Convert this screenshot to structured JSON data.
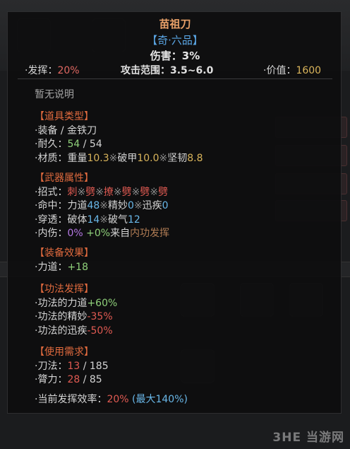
{
  "item": {
    "name": "苗祖刀",
    "grade": "【奇·六品】",
    "damage_label": "伤害：",
    "damage_value": "3%",
    "stats": {
      "attack_label": "·发挥：",
      "attack_value": "20%",
      "range_label": "攻击范围：",
      "range_value": "3.5~6.0",
      "price_label": "·价值：",
      "price_value": "1600"
    },
    "description": "暂无说明"
  },
  "sections": {
    "type": {
      "header": "【道具类型】",
      "equip": "·装备 / 金铁刀",
      "durability_label": "·耐久：",
      "durability_current": "54",
      "durability_sep": " / ",
      "durability_max": "54",
      "material_label": "·材质：",
      "material_weight_label": "重量",
      "material_weight": "10.3",
      "material_sep1": "※",
      "material_pierce_label": "破甲",
      "material_pierce": "10.0",
      "material_sep2": "※",
      "material_tough_label": "坚韧",
      "material_tough": "8.8"
    },
    "weapon": {
      "header": "【武器属性】",
      "moves_label": "·招式：",
      "moves": [
        "刺",
        "劈",
        "撩",
        "劈",
        "劈",
        "劈"
      ],
      "moves_sep": "※",
      "hit_label": "·命中：",
      "hit_a_label": "力道",
      "hit_a": "48",
      "hit_sep1": "※",
      "hit_b_label": "精妙",
      "hit_b": "0",
      "hit_sep2": "※",
      "hit_c_label": "迅疾",
      "hit_c": "0",
      "pen_label": "·穿透：",
      "pen_a_label": "破体",
      "pen_a": "14",
      "pen_sep": "※",
      "pen_b_label": "破气",
      "pen_b": "12",
      "inner_label": "·内伤：",
      "inner_a": "0%",
      "inner_b": "+0%",
      "inner_from": "来自",
      "inner_src": "内功发挥"
    },
    "effect": {
      "header": "【装备效果】",
      "strength_label": "·力道：",
      "strength_value": "+18"
    },
    "technique": {
      "header": "【功法发挥】",
      "l1_label": "·功法的力道",
      "l1_value": "+60%",
      "l2_label": "·功法的精妙",
      "l2_value": "-35%",
      "l3_label": "·功法的迅疾",
      "l3_value": "-50%"
    },
    "requirement": {
      "header": "【使用需求】",
      "r1_label": "·刀法：",
      "r1_current": "13",
      "r1_max": " / 185",
      "r2_label": "·膂力：",
      "r2_current": "28",
      "r2_max": " / 85",
      "eff_label": "·当前发挥效率：",
      "eff_value": "20%",
      "eff_max": "(最大140%)"
    }
  },
  "watermark": "3HE 当游网",
  "colors": {
    "title": "#e8a068",
    "grade": "#5ba7e6",
    "section_header": "#e06a3e",
    "positive": "#8fd07a",
    "negative": "#e05a52",
    "gold": "#d9b45b",
    "blue": "#69b7e8",
    "purple": "#b477e3"
  }
}
